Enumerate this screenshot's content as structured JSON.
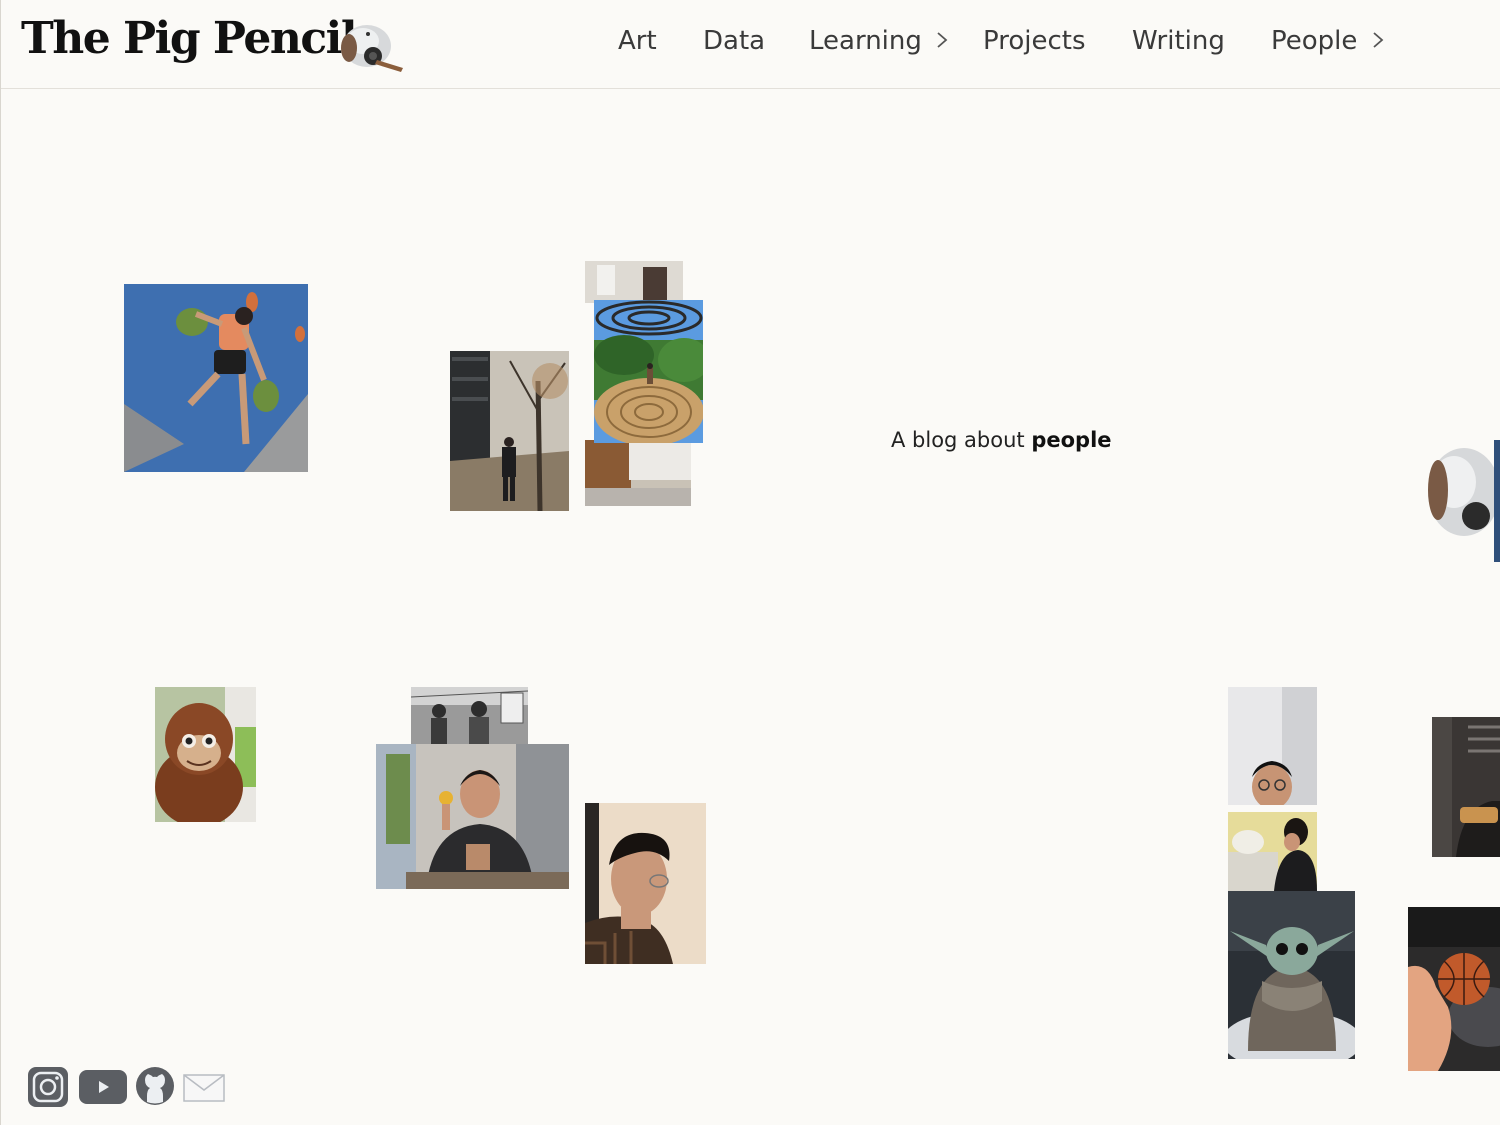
{
  "site": {
    "title": "The Pig Pencil",
    "logo_icon": "pig-pencil-sharpener-icon"
  },
  "nav": {
    "items": [
      {
        "label": "Art",
        "has_submenu": false
      },
      {
        "label": "Data",
        "has_submenu": false
      },
      {
        "label": "Learning",
        "has_submenu": true
      },
      {
        "label": "Projects",
        "has_submenu": false
      },
      {
        "label": "Writing",
        "has_submenu": false
      },
      {
        "label": "People",
        "has_submenu": true
      }
    ]
  },
  "hero": {
    "tagline_prefix": "A blog about",
    "tagline_emphasis": "people"
  },
  "photos": [
    {
      "name": "photo-climbing-wall",
      "icon": "climber-photo"
    },
    {
      "name": "photo-street-trees",
      "icon": "street-photo"
    },
    {
      "name": "photo-room-top",
      "icon": "room-photo"
    },
    {
      "name": "photo-labyrinth-garden",
      "icon": "garden-photo"
    },
    {
      "name": "photo-table-partial",
      "icon": "table-photo"
    },
    {
      "name": "photo-pig-sharpener-edge",
      "icon": "pig-sharpener-photo"
    },
    {
      "name": "photo-orangutan-plush",
      "icon": "plush-photo"
    },
    {
      "name": "photo-mural",
      "icon": "mural-photo"
    },
    {
      "name": "photo-person-with-fruit",
      "icon": "portrait-photo"
    },
    {
      "name": "photo-profile-portrait",
      "icon": "portrait-photo"
    },
    {
      "name": "photo-webcam-selfie",
      "icon": "selfie-photo"
    },
    {
      "name": "photo-kitchen",
      "icon": "kitchen-photo"
    },
    {
      "name": "photo-baby-yoda",
      "icon": "figurine-photo"
    },
    {
      "name": "photo-cafe-edge",
      "icon": "cafe-photo"
    },
    {
      "name": "photo-mini-basketball",
      "icon": "basketball-photo"
    }
  ],
  "social": [
    {
      "label": "Instagram",
      "icon": "instagram-icon"
    },
    {
      "label": "YouTube",
      "icon": "youtube-icon"
    },
    {
      "label": "GitHub",
      "icon": "github-icon"
    },
    {
      "label": "Email",
      "icon": "mail-icon"
    }
  ],
  "colors": {
    "background": "#fbfaf7",
    "text": "#1a1a1a",
    "nav_text": "#3a3a3a",
    "divider": "#e3e0da"
  }
}
